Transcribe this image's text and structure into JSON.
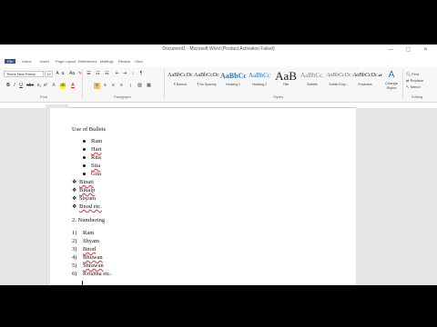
{
  "window": {
    "title": "Document1 - Microsoft Word (Product Activation Failed)",
    "controls": "— ▢ ✕"
  },
  "tabs": [
    "File",
    "Home",
    "Insert",
    "Page Layout",
    "References",
    "Mailings",
    "Review",
    "View"
  ],
  "font": {
    "name": "Times New Roma",
    "size": "12"
  },
  "groups": {
    "font": "Font",
    "paragraph": "Paragraph",
    "styles": "Styles",
    "editing": "Editing"
  },
  "styles": [
    {
      "sample": "AaBbCcDc",
      "name": "¶ Normal"
    },
    {
      "sample": "AaBbCcDc",
      "name": "¶ No Spacing"
    },
    {
      "sample": "AaBbCc",
      "name": "Heading 1"
    },
    {
      "sample": "AaBbCc",
      "name": "Heading 2"
    },
    {
      "sample": "AaB",
      "name": "Title"
    },
    {
      "sample": "AaBbCc.",
      "name": "Subtitle"
    },
    {
      "sample": "AaBbCcDc",
      "name": "Subtle Emp..."
    },
    {
      "sample": "AaBbCcDc",
      "name": "Emphasis"
    }
  ],
  "change_styles": "Change Styles",
  "editing": {
    "find": "Find",
    "replace": "Replace",
    "select": "Select"
  },
  "document": {
    "heading1": "Use of Bullets",
    "dot_items": [
      "Ram",
      "Hari",
      "Rita",
      "Sita",
      "Gita"
    ],
    "diamond_items": [
      "Binati",
      "Bikalp",
      "Shyam",
      "Bnod etc."
    ],
    "heading2": "2. Numbering",
    "numbered": [
      {
        "num": "1)",
        "text": "Ram"
      },
      {
        "num": "2)",
        "text": "Shyam"
      },
      {
        "num": "3)",
        "text": "Bnod"
      },
      {
        "num": "4)",
        "text": "Bhuwan"
      },
      {
        "num": "5)",
        "text": "Shrawan"
      },
      {
        "num": "6)",
        "text": "Krishna etc."
      }
    ]
  }
}
